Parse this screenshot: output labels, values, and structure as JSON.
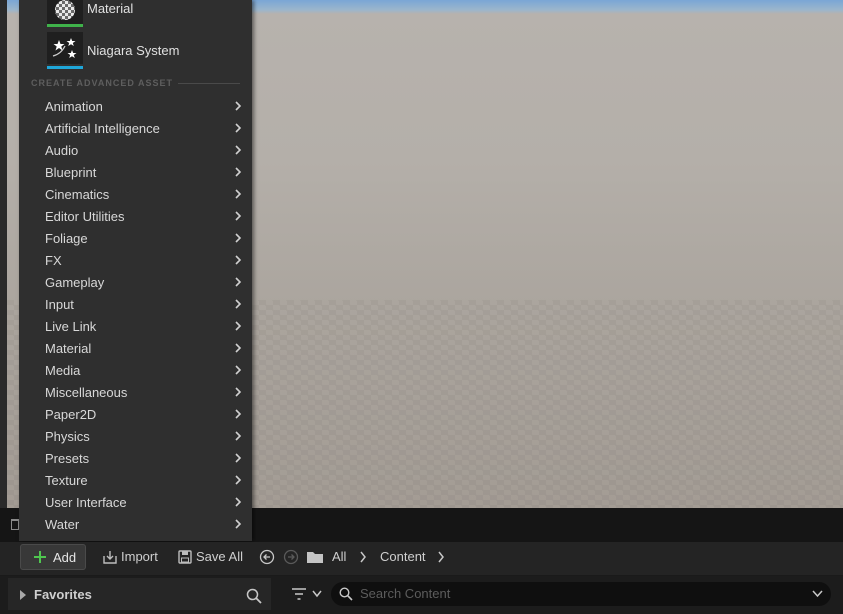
{
  "menu": {
    "top_assets": [
      {
        "label": "Material",
        "bar_color": "#3fb24a"
      },
      {
        "label": "Niagara System",
        "bar_color": "#1fa6d8"
      }
    ],
    "section_header": "CREATE ADVANCED ASSET",
    "categories": [
      {
        "label": "Animation"
      },
      {
        "label": "Artificial Intelligence"
      },
      {
        "label": "Audio"
      },
      {
        "label": "Blueprint"
      },
      {
        "label": "Cinematics"
      },
      {
        "label": "Editor Utilities"
      },
      {
        "label": "Foliage"
      },
      {
        "label": "FX"
      },
      {
        "label": "Gameplay"
      },
      {
        "label": "Input"
      },
      {
        "label": "Live Link"
      },
      {
        "label": "Material"
      },
      {
        "label": "Media"
      },
      {
        "label": "Miscellaneous"
      },
      {
        "label": "Paper2D"
      },
      {
        "label": "Physics"
      },
      {
        "label": "Presets"
      },
      {
        "label": "Texture"
      },
      {
        "label": "User Interface"
      },
      {
        "label": "Water"
      }
    ]
  },
  "toolbar": {
    "add_label": "Add",
    "import_label": "Import",
    "save_all_label": "Save All",
    "breadcrumb": [
      "All",
      "Content"
    ]
  },
  "filter": {
    "favorites_label": "Favorites",
    "search_placeholder": "Search Content"
  },
  "colors": {
    "accent_green": "#3fb24a",
    "accent_blue": "#1fa6d8"
  }
}
